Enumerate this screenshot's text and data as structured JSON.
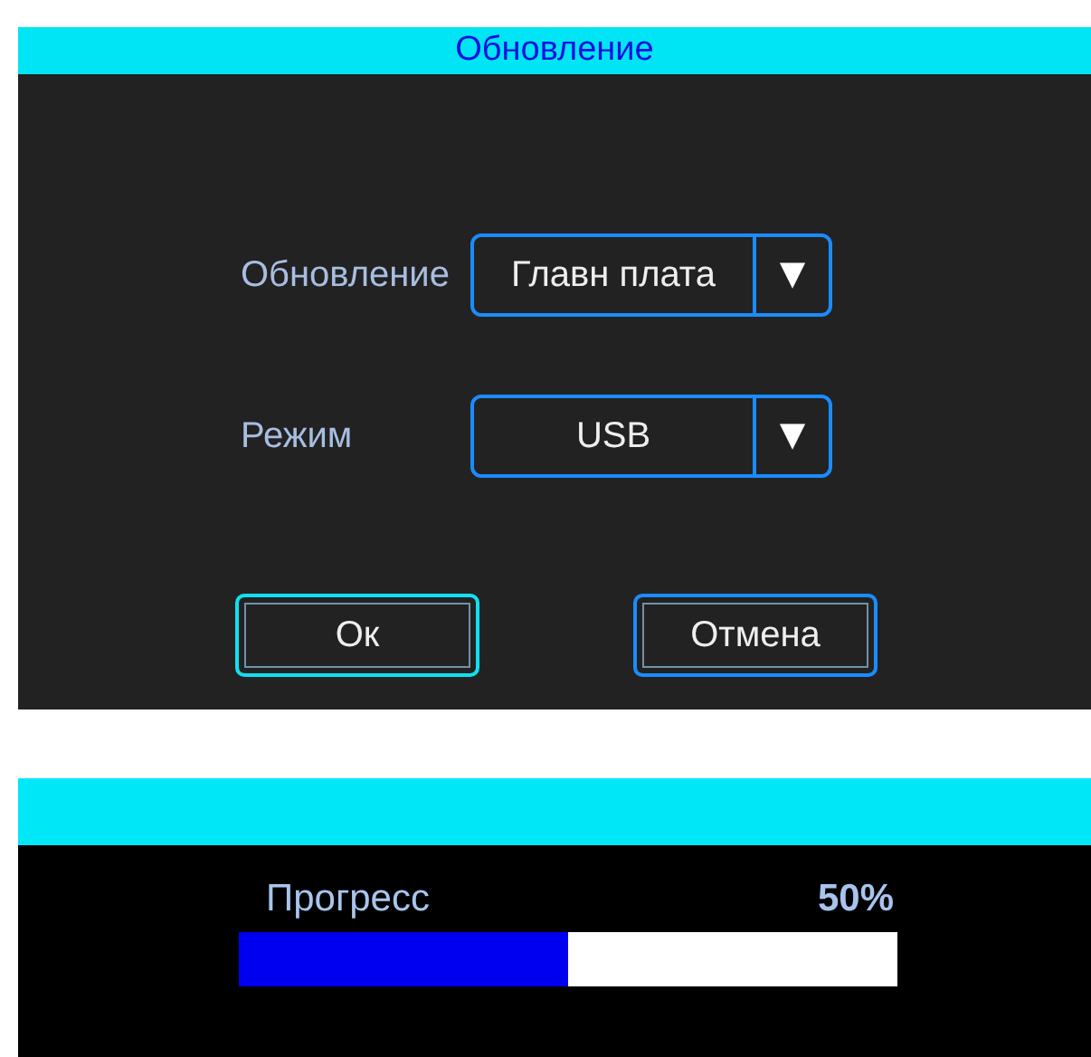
{
  "dialog": {
    "title": "Обновление",
    "fields": [
      {
        "label": "Обновление",
        "value": "Главн плата",
        "arrow": "▼"
      },
      {
        "label": "Режим",
        "value": "USB",
        "arrow": "▼"
      }
    ],
    "buttons": [
      {
        "label": "Ок",
        "selected": true
      },
      {
        "label": "Отмена",
        "selected": false
      }
    ]
  },
  "progress": {
    "label": "Прогресс",
    "reading": "50%",
    "level": 0.5
  }
}
